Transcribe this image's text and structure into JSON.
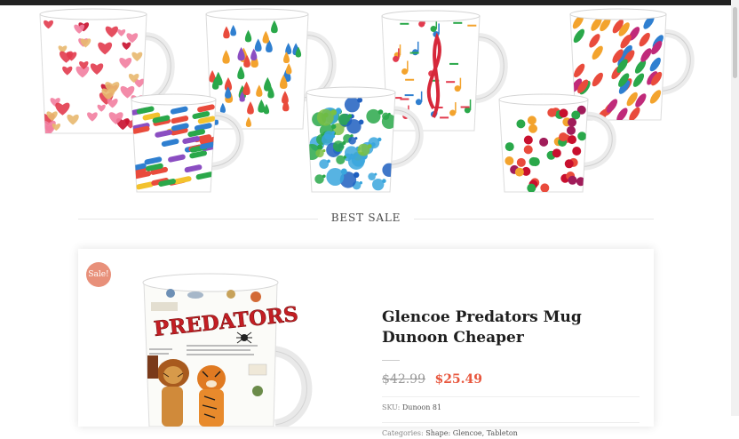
{
  "section": {
    "title": "BEST SALE"
  },
  "hero": {
    "mugs": [
      {
        "name": "hearts-mug",
        "pattern": "hearts",
        "colors": [
          "#e23b4e",
          "#f27ea0",
          "#e8b86f",
          "#c8102e"
        ]
      },
      {
        "name": "raindrops-mug",
        "pattern": "drops",
        "colors": [
          "#e94b3c",
          "#f3a32d",
          "#2aa84a",
          "#2f7fd0",
          "#8b4ec2"
        ]
      },
      {
        "name": "music-notes-mug",
        "pattern": "music",
        "colors": [
          "#e23b4e",
          "#2f7fd0",
          "#2aa84a",
          "#f3a32d"
        ]
      },
      {
        "name": "feathers-mug",
        "pattern": "feathers",
        "colors": [
          "#e94b3c",
          "#2f7fd0",
          "#2aa84a",
          "#f3a32d",
          "#c02a7a"
        ]
      },
      {
        "name": "brush-strokes-mug",
        "pattern": "strokes",
        "colors": [
          "#2f7fd0",
          "#e94b3c",
          "#f3c22d",
          "#2aa84a",
          "#8b4ec2"
        ]
      },
      {
        "name": "blue-splash-mug",
        "pattern": "splash",
        "colors": [
          "#1f5fbf",
          "#3aa6dd",
          "#2aa84a",
          "#7ac043"
        ]
      },
      {
        "name": "polka-dots-mug",
        "pattern": "dots",
        "colors": [
          "#c8102e",
          "#f3a32d",
          "#2aa84a",
          "#a01c5a",
          "#e94b3c"
        ]
      }
    ]
  },
  "product": {
    "badge": "Sale!",
    "title": "Glencoe Predators Mug Dunoon Cheaper",
    "old_price": "$42.99",
    "new_price": "$25.49",
    "sku_label": "SKU:",
    "sku": "Dunoon 81",
    "categories_label": "Categories:",
    "categories": "Shape: Glencoe, Tableton",
    "image": {
      "mug_text": "PREDATORS"
    }
  }
}
